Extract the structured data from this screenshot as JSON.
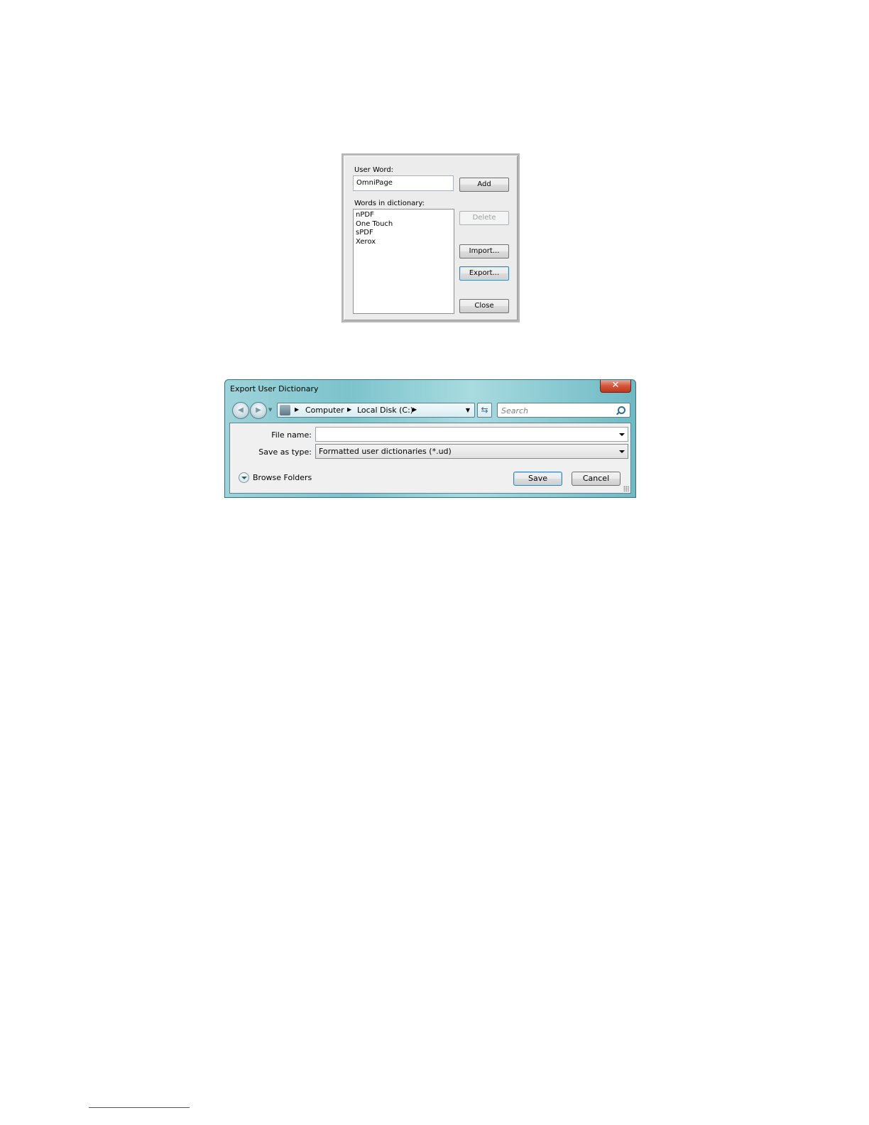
{
  "user_dictionary_dialog": {
    "user_word_label": "User Word:",
    "user_word_value": "OmniPage",
    "words_label": "Words in dictionary:",
    "words": [
      "nPDF",
      "One Touch",
      "sPDF",
      "Xerox"
    ],
    "buttons": {
      "add": "Add",
      "delete": "Delete",
      "import": "Import...",
      "export": "Export...",
      "close": "Close"
    }
  },
  "export_dialog": {
    "title": "Export User Dictionary",
    "close_glyph": "✕",
    "breadcrumb": [
      "Computer",
      "Local Disk (C:)"
    ],
    "search_placeholder": "Search",
    "file_name_label": "File name:",
    "file_name_value": "",
    "save_as_type_label": "Save as type:",
    "save_as_type_value": "Formatted user dictionaries (*.ud)",
    "browse_folders": "Browse Folders",
    "save_button": "Save",
    "cancel_button": "Cancel"
  }
}
